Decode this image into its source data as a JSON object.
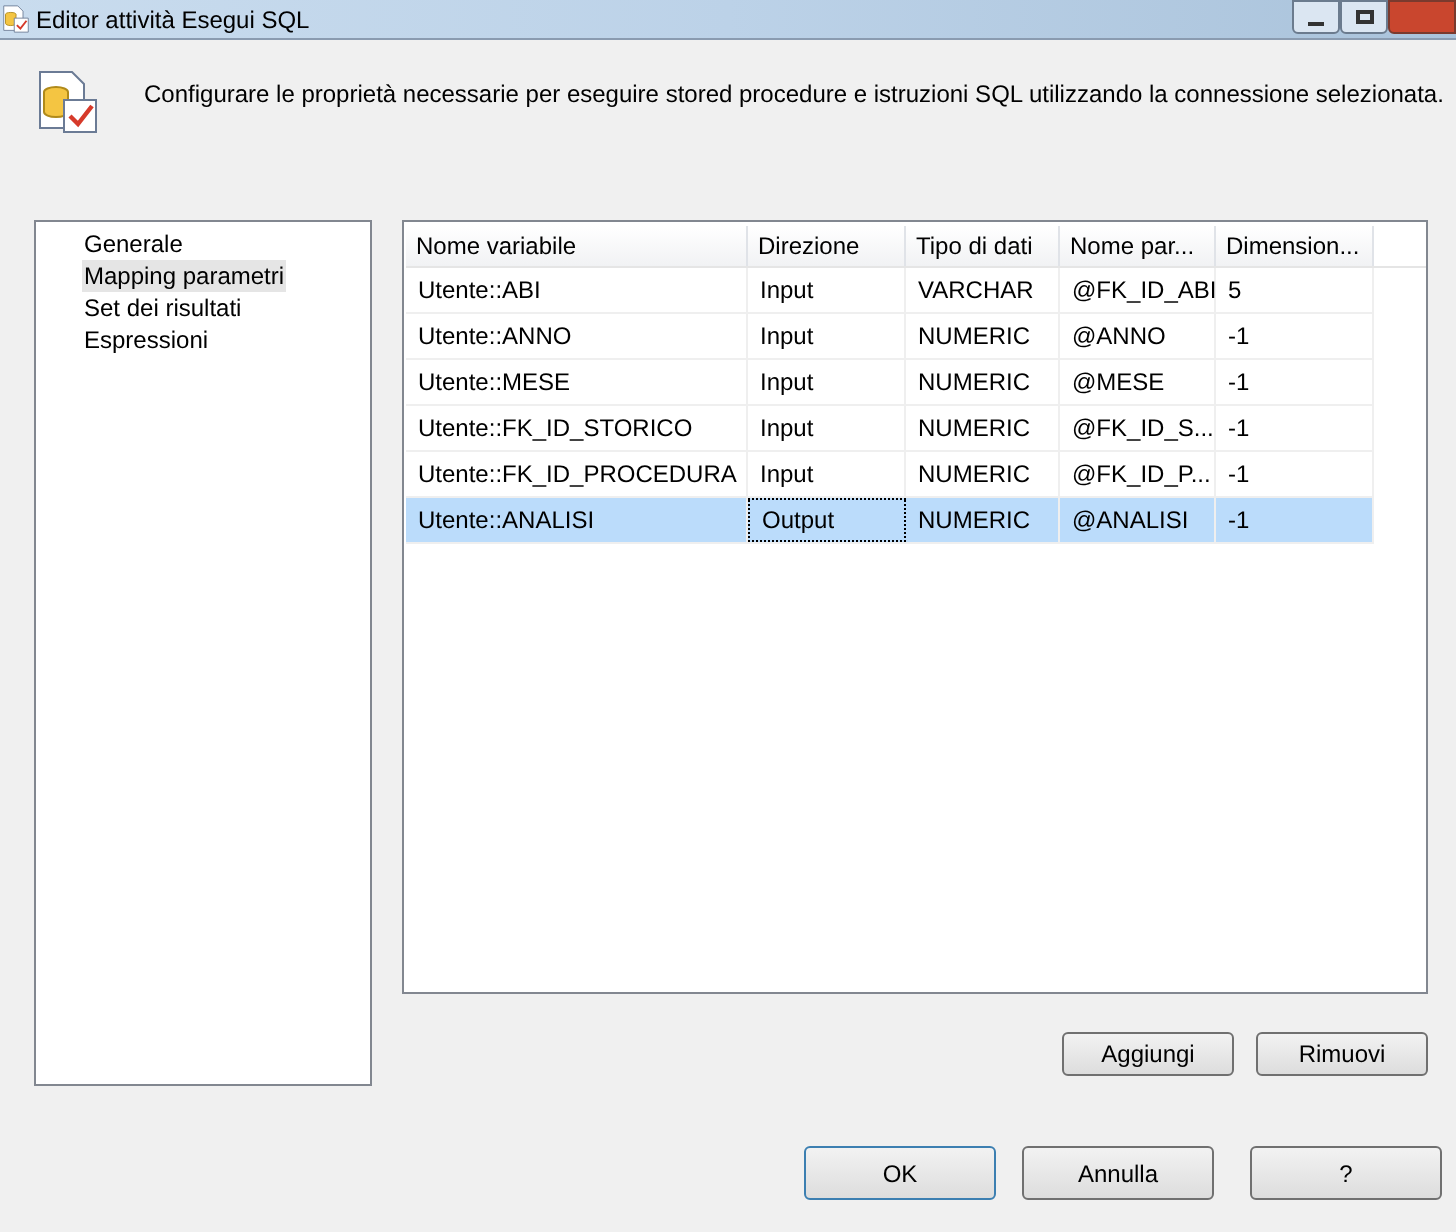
{
  "window": {
    "title": "Editor attività Esegui SQL"
  },
  "description": "Configurare le proprietà necessarie per eseguire stored procedure e istruzioni SQL utilizzando la connessione selezionata.",
  "sidebar": {
    "items": [
      {
        "label": "Generale",
        "selected": false
      },
      {
        "label": "Mapping parametri",
        "selected": true
      },
      {
        "label": "Set dei risultati",
        "selected": false
      },
      {
        "label": "Espressioni",
        "selected": false
      }
    ]
  },
  "table": {
    "columns": [
      "Nome variabile",
      "Direzione",
      "Tipo di dati",
      "Nome par...",
      "Dimension..."
    ],
    "rows": [
      {
        "cells": [
          "Utente::ABI",
          "Input",
          "VARCHAR",
          "@FK_ID_ABI",
          "5"
        ],
        "selected": false
      },
      {
        "cells": [
          "Utente::ANNO",
          "Input",
          "NUMERIC",
          "@ANNO",
          "-1"
        ],
        "selected": false
      },
      {
        "cells": [
          "Utente::MESE",
          "Input",
          "NUMERIC",
          "@MESE",
          "-1"
        ],
        "selected": false
      },
      {
        "cells": [
          "Utente::FK_ID_STORICO",
          "Input",
          "NUMERIC",
          "@FK_ID_S...",
          "-1"
        ],
        "selected": false
      },
      {
        "cells": [
          "Utente::FK_ID_PROCEDURA",
          "Input",
          "NUMERIC",
          "@FK_ID_P...",
          "-1"
        ],
        "selected": false
      },
      {
        "cells": [
          "Utente::ANALISI",
          "Output",
          "NUMERIC",
          "@ANALISI",
          "-1"
        ],
        "selected": true
      }
    ]
  },
  "table_buttons": [
    "Aggiungi",
    "Rimuovi"
  ],
  "buttons": [
    {
      "label": "OK",
      "default": true
    },
    {
      "label": "Annulla",
      "default": false
    },
    {
      "label": "?",
      "default": false
    }
  ]
}
